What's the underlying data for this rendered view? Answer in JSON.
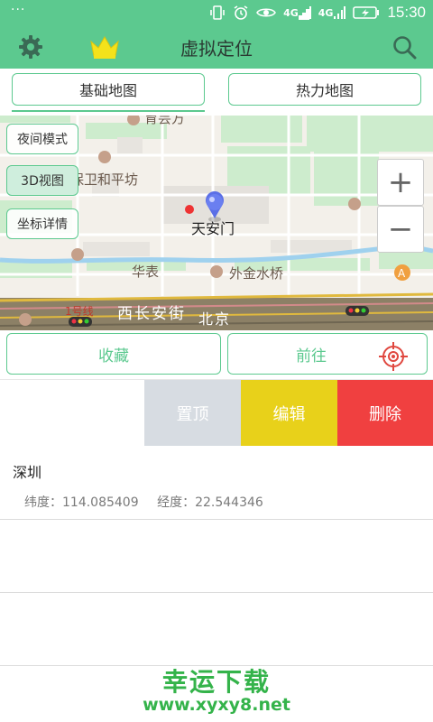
{
  "status_bar": {
    "left": "···",
    "network1": "4G",
    "network2": "4G",
    "time": "15:30"
  },
  "header": {
    "title": "虚拟定位"
  },
  "tabs": [
    {
      "label": "基础地图"
    },
    {
      "label": "热力地图"
    }
  ],
  "map": {
    "side_buttons": [
      {
        "label": "夜间模式"
      },
      {
        "label": "3D视图"
      },
      {
        "label": "坐标详情"
      }
    ],
    "labels": {
      "yunfang": "育芸方",
      "baowei": "保卫和平坊",
      "tiananmen": "天安门",
      "huabiao": "华表",
      "waijin": "外金水桥",
      "xichang": "西长安街",
      "line1": "1号线",
      "beijing": "北京"
    },
    "zoom_in": "+",
    "zoom_out": "−"
  },
  "actions": {
    "favorite": "收藏",
    "goto": "前往"
  },
  "swipe_actions": {
    "pin": "置顶",
    "edit": "编辑",
    "delete": "删除"
  },
  "locations": [
    {
      "name": "深圳",
      "lat_label": "纬度：",
      "lat": "114.085409",
      "lng_label": "经度：",
      "lng": "22.544346"
    }
  ],
  "watermark": {
    "title": "幸运下载",
    "url": "www.xyxy8.net"
  },
  "colors": {
    "primary": "#5cc98f",
    "edit": "#e8d11a",
    "delete": "#f04040",
    "pin": "#d7dce2"
  }
}
